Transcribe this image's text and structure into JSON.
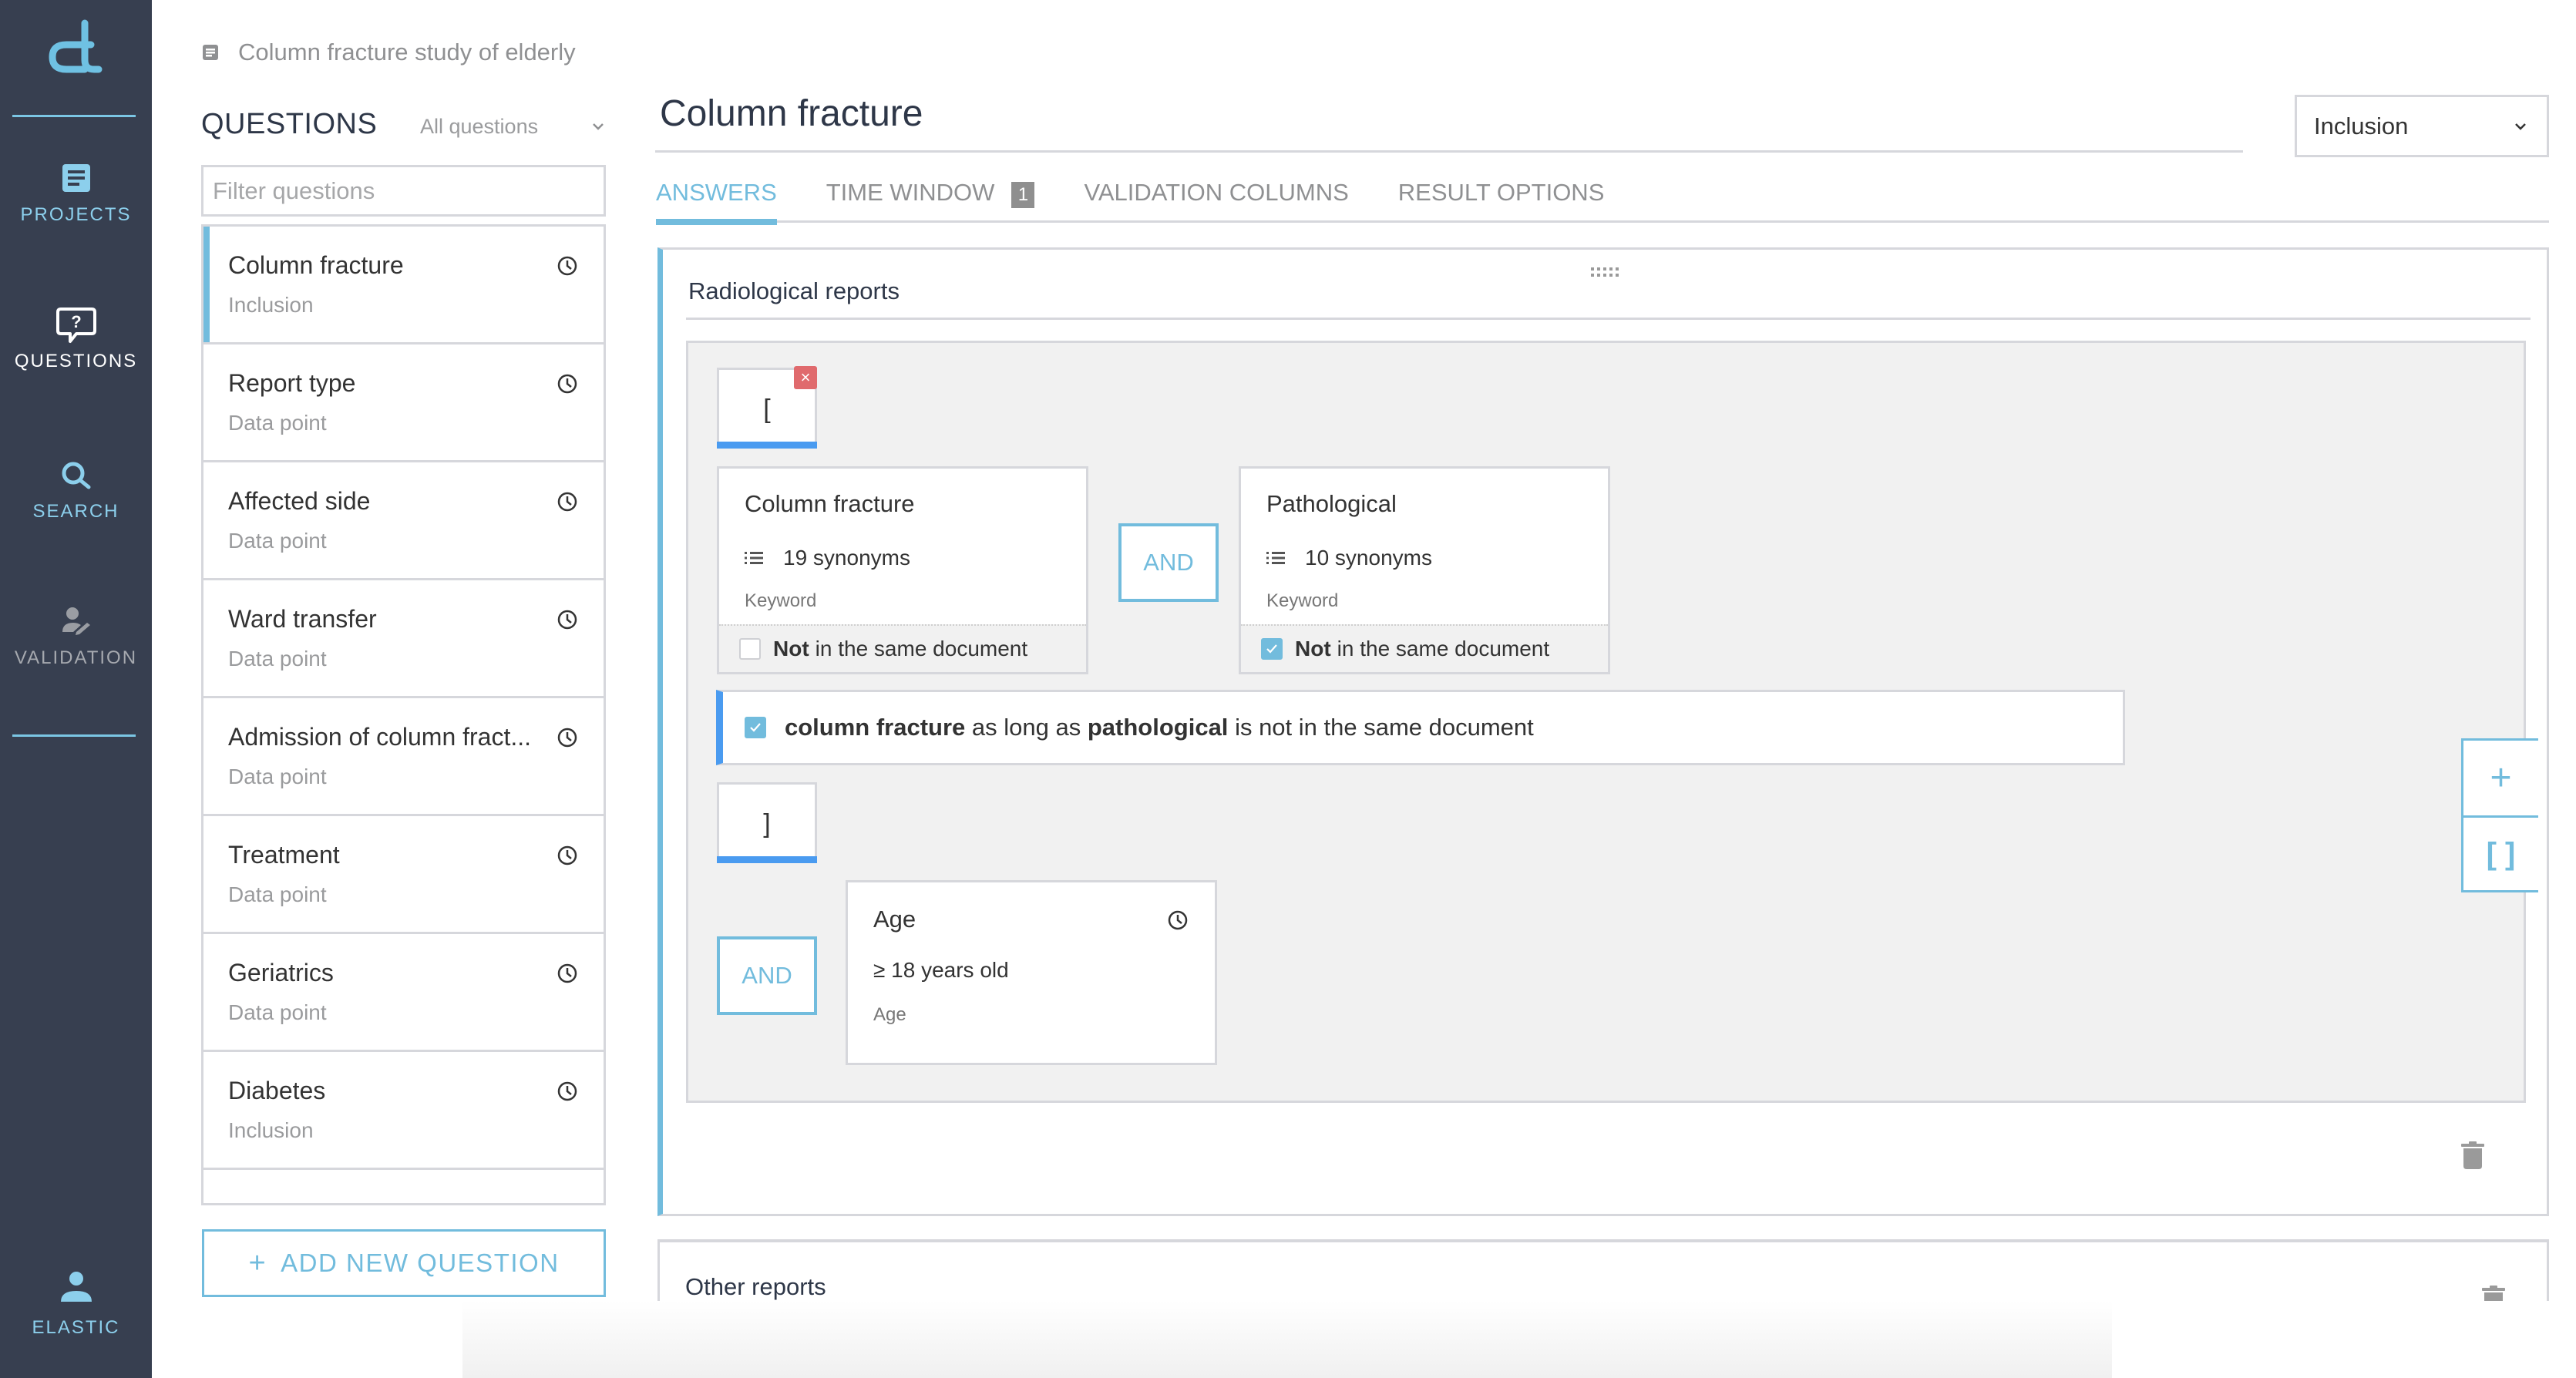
{
  "colors": {
    "sidebar_bg": "#373f50",
    "accent": "#72bcdd",
    "bracket_blue": "#4a9bf0",
    "remove_red": "#e06a6d",
    "border": "#d6d7dc",
    "builder_bg": "#f1f1f1"
  },
  "sidebar": {
    "logo": "dt-logo",
    "items": [
      {
        "label": "PROJECTS",
        "icon": "document-icon",
        "state": "normal"
      },
      {
        "label": "QUESTIONS",
        "icon": "question-bubble-icon",
        "state": "active"
      },
      {
        "label": "SEARCH",
        "icon": "search-icon",
        "state": "normal"
      },
      {
        "label": "VALIDATION",
        "icon": "user-edit-icon",
        "state": "disabled"
      }
    ],
    "user": {
      "label": "ELASTIC",
      "icon": "user-icon"
    }
  },
  "breadcrumb": {
    "icon": "document-icon",
    "text": "Column fracture study of elderly"
  },
  "questions_panel": {
    "title": "QUESTIONS",
    "filter_select": "All questions",
    "filter_placeholder": "Filter questions",
    "filter_value": "",
    "items": [
      {
        "name": "Column fracture",
        "type": "Inclusion",
        "active": true
      },
      {
        "name": "Report type",
        "type": "Data point",
        "active": false
      },
      {
        "name": "Affected side",
        "type": "Data point",
        "active": false
      },
      {
        "name": "Ward transfer",
        "type": "Data point",
        "active": false
      },
      {
        "name": "Admission of column fract...",
        "type": "Data point",
        "active": false
      },
      {
        "name": "Treatment",
        "type": "Data point",
        "active": false
      },
      {
        "name": "Geriatrics",
        "type": "Data point",
        "active": false
      },
      {
        "name": "Diabetes",
        "type": "Inclusion",
        "active": false
      }
    ],
    "add_button": "ADD NEW QUESTION"
  },
  "main": {
    "title": "Column fracture",
    "type_select": "Inclusion",
    "tabs": [
      {
        "label": "ANSWERS",
        "active": true
      },
      {
        "label": "TIME WINDOW",
        "badge": "1",
        "active": false
      },
      {
        "label": "VALIDATION COLUMNS",
        "active": false
      },
      {
        "label": "RESULT OPTIONS",
        "active": false
      }
    ]
  },
  "answer_card": {
    "title": "Radiological reports",
    "open_bracket": "[",
    "close_bracket": "]",
    "remove_symbol": "×",
    "keywords": [
      {
        "title": "Column fracture",
        "synonyms": "19 synonyms",
        "type": "Keyword",
        "not_label_bold": "Not",
        "not_label_rest": "in the same document",
        "not_checked": false
      },
      {
        "title": "Pathological",
        "synonyms": "10 synonyms",
        "type": "Keyword",
        "not_label_bold": "Not",
        "not_label_rest": "in the same document",
        "not_checked": true
      }
    ],
    "operator_1": "AND",
    "summary": {
      "checked": true,
      "term1": "column fracture",
      "middle": "as long as",
      "term2": "pathological",
      "end": "is not in the same document"
    },
    "operator_2": "AND",
    "age": {
      "title": "Age",
      "condition": "≥ 18 years old",
      "type": "Age"
    },
    "tools": {
      "add": "+",
      "brackets": "[ ]"
    }
  },
  "other_card": {
    "title": "Other reports"
  }
}
